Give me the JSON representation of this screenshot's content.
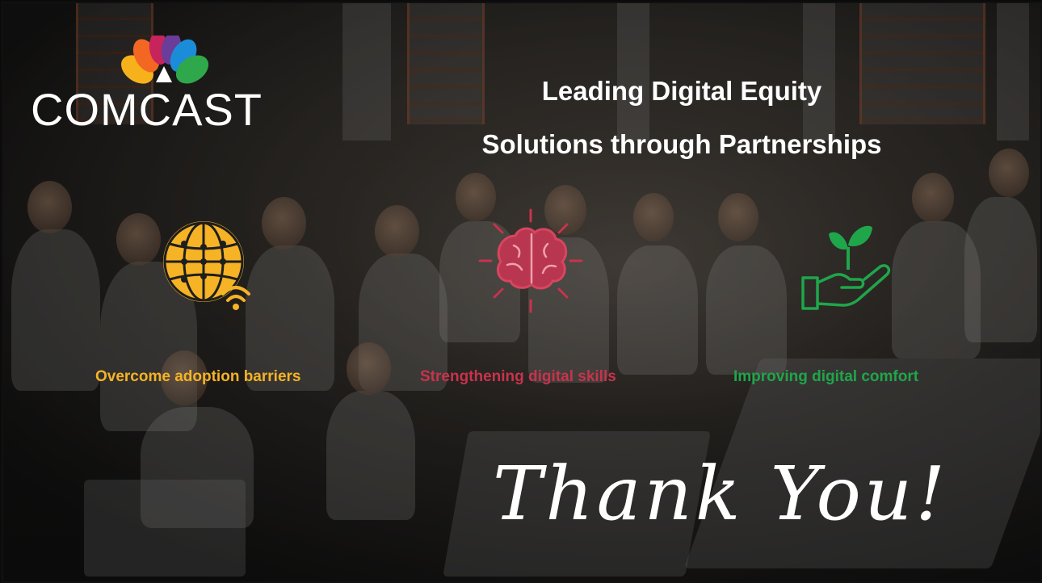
{
  "logo": {
    "text": "COMCAST"
  },
  "title": {
    "line1": "Leading Digital Equity",
    "line2": "Solutions through Partnerships"
  },
  "pillars": [
    {
      "label": "Overcome adoption barriers",
      "icon": "globe-wifi-icon",
      "color": "#f5b325"
    },
    {
      "label": "Strengthening digital skills",
      "icon": "brain-icon",
      "color": "#c8334c"
    },
    {
      "label": "Improving digital comfort",
      "icon": "plant-in-hand-icon",
      "color": "#1fa64a"
    }
  ],
  "closing": {
    "text": "Thank You!"
  },
  "colors": {
    "background": "#2b2825",
    "text": "#ffffff"
  }
}
